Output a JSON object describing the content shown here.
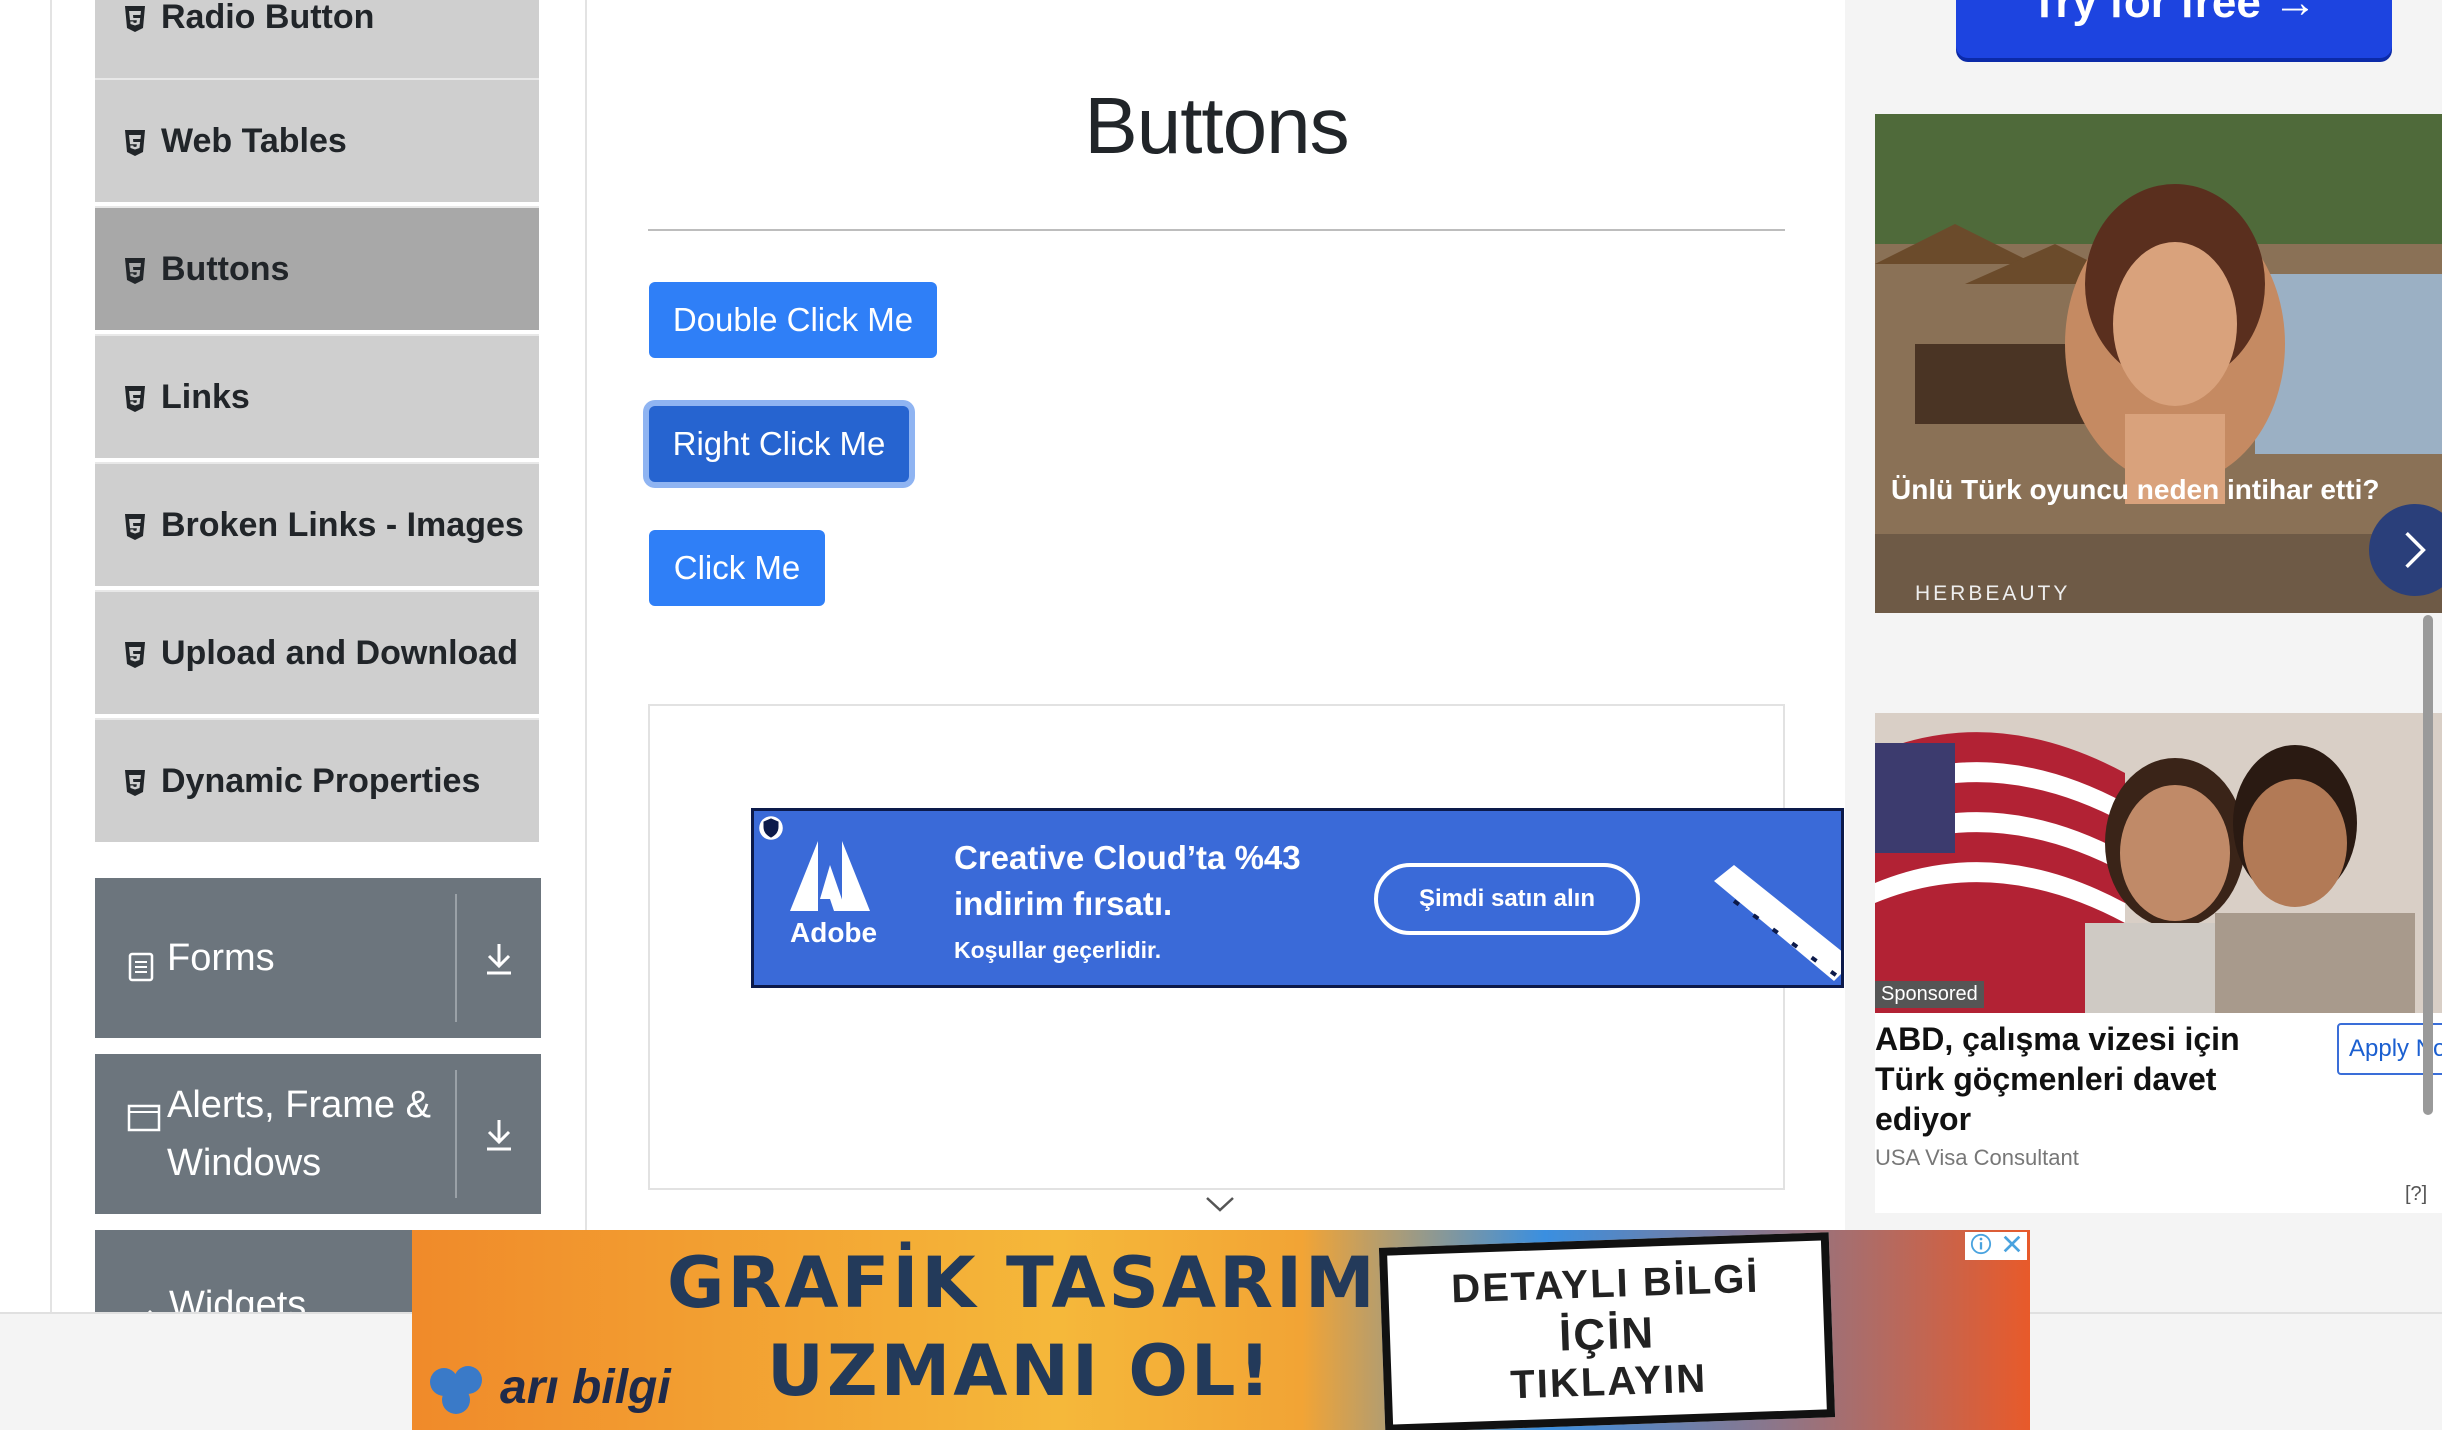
{
  "sidebar": {
    "items": [
      {
        "label": "Radio Button",
        "active": false
      },
      {
        "label": "Web Tables",
        "active": false
      },
      {
        "label": "Buttons",
        "active": true
      },
      {
        "label": "Links",
        "active": false
      },
      {
        "label": "Broken Links - Images",
        "active": false
      },
      {
        "label": "Upload and Download",
        "active": false
      },
      {
        "label": "Dynamic Properties",
        "active": false
      }
    ],
    "groups": [
      {
        "label": "Forms",
        "icon": "form-icon"
      },
      {
        "label_line1": "Alerts, Frame &",
        "label_line2": "Windows",
        "icon": "window-icon"
      },
      {
        "label": "Widgets",
        "icon": "widgets-icon"
      }
    ]
  },
  "main": {
    "title": "Buttons",
    "buttons": {
      "double_click": "Double Click Me",
      "right_click": "Right Click Me",
      "click": "Click Me"
    }
  },
  "ads": {
    "adobe": {
      "line1": "Creative Cloud’ta %43",
      "line2": "indirim fırsatı.",
      "note": "Koşullar geçerlidir.",
      "cta": "Şimdi satın alın",
      "brand": "Adobe"
    },
    "try_button": "Try for free →",
    "herbeauty": {
      "caption": "Ünlü Türk oyuncu neden intihar etti?",
      "brand": "HERBEAUTY"
    },
    "visa": {
      "sponsored": "Sponsored",
      "headline": "ABD, çalışma vizesi için Türk göçmenleri davet ediyor",
      "source": "USA Visa Consultant",
      "apply": "Apply Now",
      "help": "[?]"
    },
    "banner": {
      "line1": "GRAFİK TASARIM",
      "line2": "UZMANI OL!",
      "brand": "arı bilgi",
      "cta1": "DETAYLI BİLGİ",
      "cta2": "İÇİN",
      "cta3": "TIKLAYIN"
    }
  },
  "colors": {
    "primary_button": "#2f7ff7",
    "sidebar_item": "#cfcfcf",
    "sidebar_active": "#a8a8a8",
    "group_header": "#6c757d"
  }
}
